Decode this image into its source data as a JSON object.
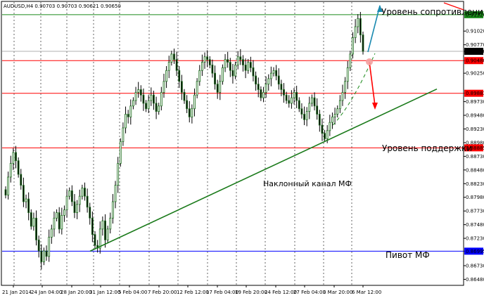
{
  "chart_data": {
    "type": "candlestick",
    "title": "AUDUSD,H4  0.90703 0.90703 0.90621 0.90650",
    "symbol": "AUDUSD",
    "timeframe": "H4",
    "ohlc_header": [
      "0.90703",
      "0.90703",
      "0.90621",
      "0.90650"
    ],
    "y_range": [
      0.8637,
      0.9155
    ],
    "y_ticks": [
      "0.91320",
      "0.91020",
      "0.90770",
      "0.90650",
      "0.90480",
      "0.90250",
      "0.89883",
      "0.89730",
      "0.89480",
      "0.89230",
      "0.88980",
      "0.88885",
      "0.88730",
      "0.88480",
      "0.88230",
      "0.87980",
      "0.87730",
      "0.87480",
      "0.87230",
      "0.86995",
      "0.86730",
      "0.86480"
    ],
    "highlighted_ticks": [
      {
        "value": "0.91320",
        "color": "#1a8a1a"
      },
      {
        "value": "0.90650",
        "color": "#000000"
      },
      {
        "value": "0.90480",
        "color": "#ff0000"
      },
      {
        "value": "0.89883",
        "color": "#ff0000"
      },
      {
        "value": "0.88885",
        "color": "#ff0000"
      },
      {
        "value": "0.86995",
        "color": "#0000ff"
      }
    ],
    "x_labels": [
      "21 Jan 2014",
      "24 Jan 04:00",
      "28 Jan 20:00",
      "31 Jan 12:00",
      "5 Feb 04:00",
      "7 Feb 20:00",
      "12 Feb 12:00",
      "17 Feb 04:00",
      "19 Feb 20:00",
      "24 Feb 12:00",
      "27 Feb 04:00",
      "3 Mar 20:00",
      "6 Mar 12:00"
    ],
    "levels": [
      {
        "price": 0.9132,
        "color": "#1a8a1a",
        "label": "Уровень сопротивления"
      },
      {
        "price": 0.9048,
        "color": "#ff0000",
        "label": ""
      },
      {
        "price": 0.89883,
        "color": "#ff0000",
        "label": ""
      },
      {
        "price": 0.88885,
        "color": "#ff0000",
        "label": "Уровень поддержки"
      },
      {
        "price": 0.86995,
        "color": "#0000ff",
        "label": "Пивот МФ"
      }
    ],
    "current_price": 0.9065,
    "trendline": {
      "label": "Наклонный канал МФ",
      "color": "#1a7a1a",
      "from": {
        "x": "31 Jan",
        "price": 0.86995
      },
      "to": {
        "x": "10 Mar",
        "price": 0.8996
      }
    },
    "grid": true,
    "colors": {
      "bull": "#1a6b1a",
      "bear": "#1a6b1a",
      "candle_fill_up": "#ffffff",
      "candle_fill_down": "#000000",
      "forecast_up": "#1a8ab0",
      "forecast_down": "#ff0000"
    },
    "candles_close": [
      0.8802,
      0.8835,
      0.886,
      0.888,
      0.8865,
      0.884,
      0.882,
      0.879,
      0.8795,
      0.877,
      0.8745,
      0.876,
      0.872,
      0.87,
      0.868,
      0.87,
      0.869,
      0.8725,
      0.874,
      0.876,
      0.877,
      0.874,
      0.8765,
      0.8775,
      0.88,
      0.881,
      0.879,
      0.877,
      0.8785,
      0.88,
      0.8815,
      0.88,
      0.878,
      0.876,
      0.873,
      0.871,
      0.8705,
      0.874,
      0.8755,
      0.872,
      0.874,
      0.876,
      0.879,
      0.882,
      0.886,
      0.89,
      0.8925,
      0.895,
      0.8945,
      0.8965,
      0.8975,
      0.899,
      0.8995,
      0.8985,
      0.897,
      0.896,
      0.8975,
      0.8985,
      0.897,
      0.8955,
      0.8965,
      0.899,
      0.901,
      0.903,
      0.9045,
      0.906,
      0.905,
      0.903,
      0.901,
      0.899,
      0.8975,
      0.896,
      0.8945,
      0.896,
      0.8985,
      0.901,
      0.903,
      0.9045,
      0.9055,
      0.905,
      0.904,
      0.9025,
      0.9005,
      0.899,
      0.901,
      0.9035,
      0.905,
      0.9045,
      0.903,
      0.902,
      0.904,
      0.9055,
      0.905,
      0.904,
      0.903,
      0.9045,
      0.9035,
      0.902,
      0.9005,
      0.8995,
      0.898,
      0.899,
      0.9005,
      0.9015,
      0.9025,
      0.903,
      0.902,
      0.9005,
      0.8995,
      0.8985,
      0.8975,
      0.897,
      0.898,
      0.899,
      0.8975,
      0.896,
      0.895,
      0.894,
      0.8955,
      0.897,
      0.898,
      0.8965,
      0.895,
      0.893,
      0.8915,
      0.8905,
      0.892,
      0.8935,
      0.8945,
      0.895,
      0.896,
      0.8975,
      0.899,
      0.901,
      0.9035,
      0.906,
      0.909,
      0.911,
      0.9125,
      0.9095,
      0.9065
    ]
  },
  "annotations": {
    "resistance": "Уровень сопротивления",
    "support": "Уровень поддержки",
    "channel": "Наклонный канал МФ",
    "pivot": "Пивот МФ"
  }
}
